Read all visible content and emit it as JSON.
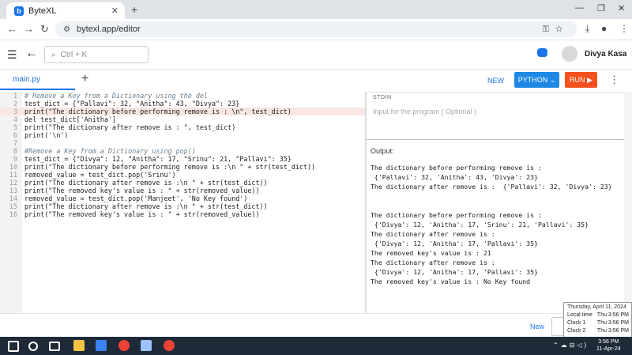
{
  "browser": {
    "tab_title": "ByteXL",
    "tab_close": "✕",
    "new_tab": "+",
    "url": "bytexl.app/editor",
    "min": "—",
    "restore": "❐",
    "close": "✕"
  },
  "app": {
    "search_placeholder": "Ctrl + K",
    "user_name": "Divya Kasa"
  },
  "editor": {
    "file_tab": "main.py",
    "add_file": "+",
    "new_label": "NEW",
    "language_label": "PYTHON ⌄",
    "run_label": "RUN ▶",
    "code_lines": [
      {
        "n": "1",
        "text": "# Remove a Key from a Dictionary using the del"
      },
      {
        "n": "2",
        "text": "test_dict = {\"Pallavi\": 32, \"Anitha\": 43, \"Divya\": 23}"
      },
      {
        "n": "3",
        "text": "print(\"The dictionary before performing remove is : \\n\", test_dict)"
      },
      {
        "n": "4",
        "text": "del test_dict['Anitha']"
      },
      {
        "n": "5",
        "text": "print(\"The dictionary after remove is : \", test_dict)"
      },
      {
        "n": "6",
        "text": "print('\\n')"
      },
      {
        "n": "7",
        "text": ""
      },
      {
        "n": "8",
        "text": "#Remove a Key from a Dictionary using pop()"
      },
      {
        "n": "9",
        "text": "test_dict = {\"Divya\": 12, \"Anitha\": 17, \"Srinu\": 21, \"Pallavi\": 35}"
      },
      {
        "n": "10",
        "text": "print(\"The dictionary before performing remove is :\\n \" + str(test_dict))"
      },
      {
        "n": "11",
        "text": "removed_value = test_dict.pop('Srinu')"
      },
      {
        "n": "12",
        "text": "print(\"The dictionary after remove is :\\n \" + str(test_dict))"
      },
      {
        "n": "13",
        "text": "print(\"The removed key's value is : \" + str(removed_value))"
      },
      {
        "n": "14",
        "text": "removed_value = test_dict.pop('Manjeet', 'No Key found')"
      },
      {
        "n": "15",
        "text": "print(\"The dictionary after remove is :\\n \" + str(test_dict))"
      },
      {
        "n": "16",
        "text": "print(\"The removed key's value is : \" + str(removed_value))"
      }
    ],
    "highlighted_line": 3
  },
  "io": {
    "stdin_label": "STDIN",
    "stdin_placeholder": "Input for the program ( Optional )",
    "output_label": "Output:",
    "output_lines": [
      "The dictionary before performing remove is :",
      " {'Pallavi': 32, 'Anitha': 43, 'Divya': 23}",
      "The dictionary after remove is :  {'Pallavi': 32, 'Divya': 23}",
      "",
      "",
      "The dictionary before performing remove is :",
      " {'Divya': 12, 'Anitha': 17, 'Srinu': 21, 'Pallavi': 35}",
      "The dictionary after remove is :",
      " {'Divya': 12, 'Anitha': 17, 'Pallavi': 35}",
      "The removed key's value is : 21",
      "The dictionary after remove is :",
      " {'Divya': 12, 'Anitha': 17, 'Pallavi': 35}",
      "The removed key's value is : No Key found"
    ]
  },
  "footer": {
    "new_label": "New"
  },
  "clock_tooltip": {
    "date": "Thursday, April 11, 2024",
    "rows": [
      {
        "label": "Local time",
        "value": "Thu 3:56 PM"
      },
      {
        "label": "Clock 1",
        "value": "Thu 3:56 PM"
      },
      {
        "label": "Clock 2",
        "value": "Thu 3:56 PM"
      }
    ]
  },
  "taskbar": {
    "time": "3:56 PM",
    "date": "11-Apr-24",
    "icons": [
      "windows-start-icon",
      "search-icon",
      "task-view-icon",
      "file-explorer-icon",
      "app-icon",
      "chrome-icon",
      "box-app-icon",
      "chrome-active-icon"
    ],
    "colors": [
      "#ffffff",
      "#ffffff",
      "#ffffff",
      "#f5c342",
      "#3b82f6",
      "#ea4335",
      "#9cc3ff",
      "#ea4335"
    ]
  }
}
